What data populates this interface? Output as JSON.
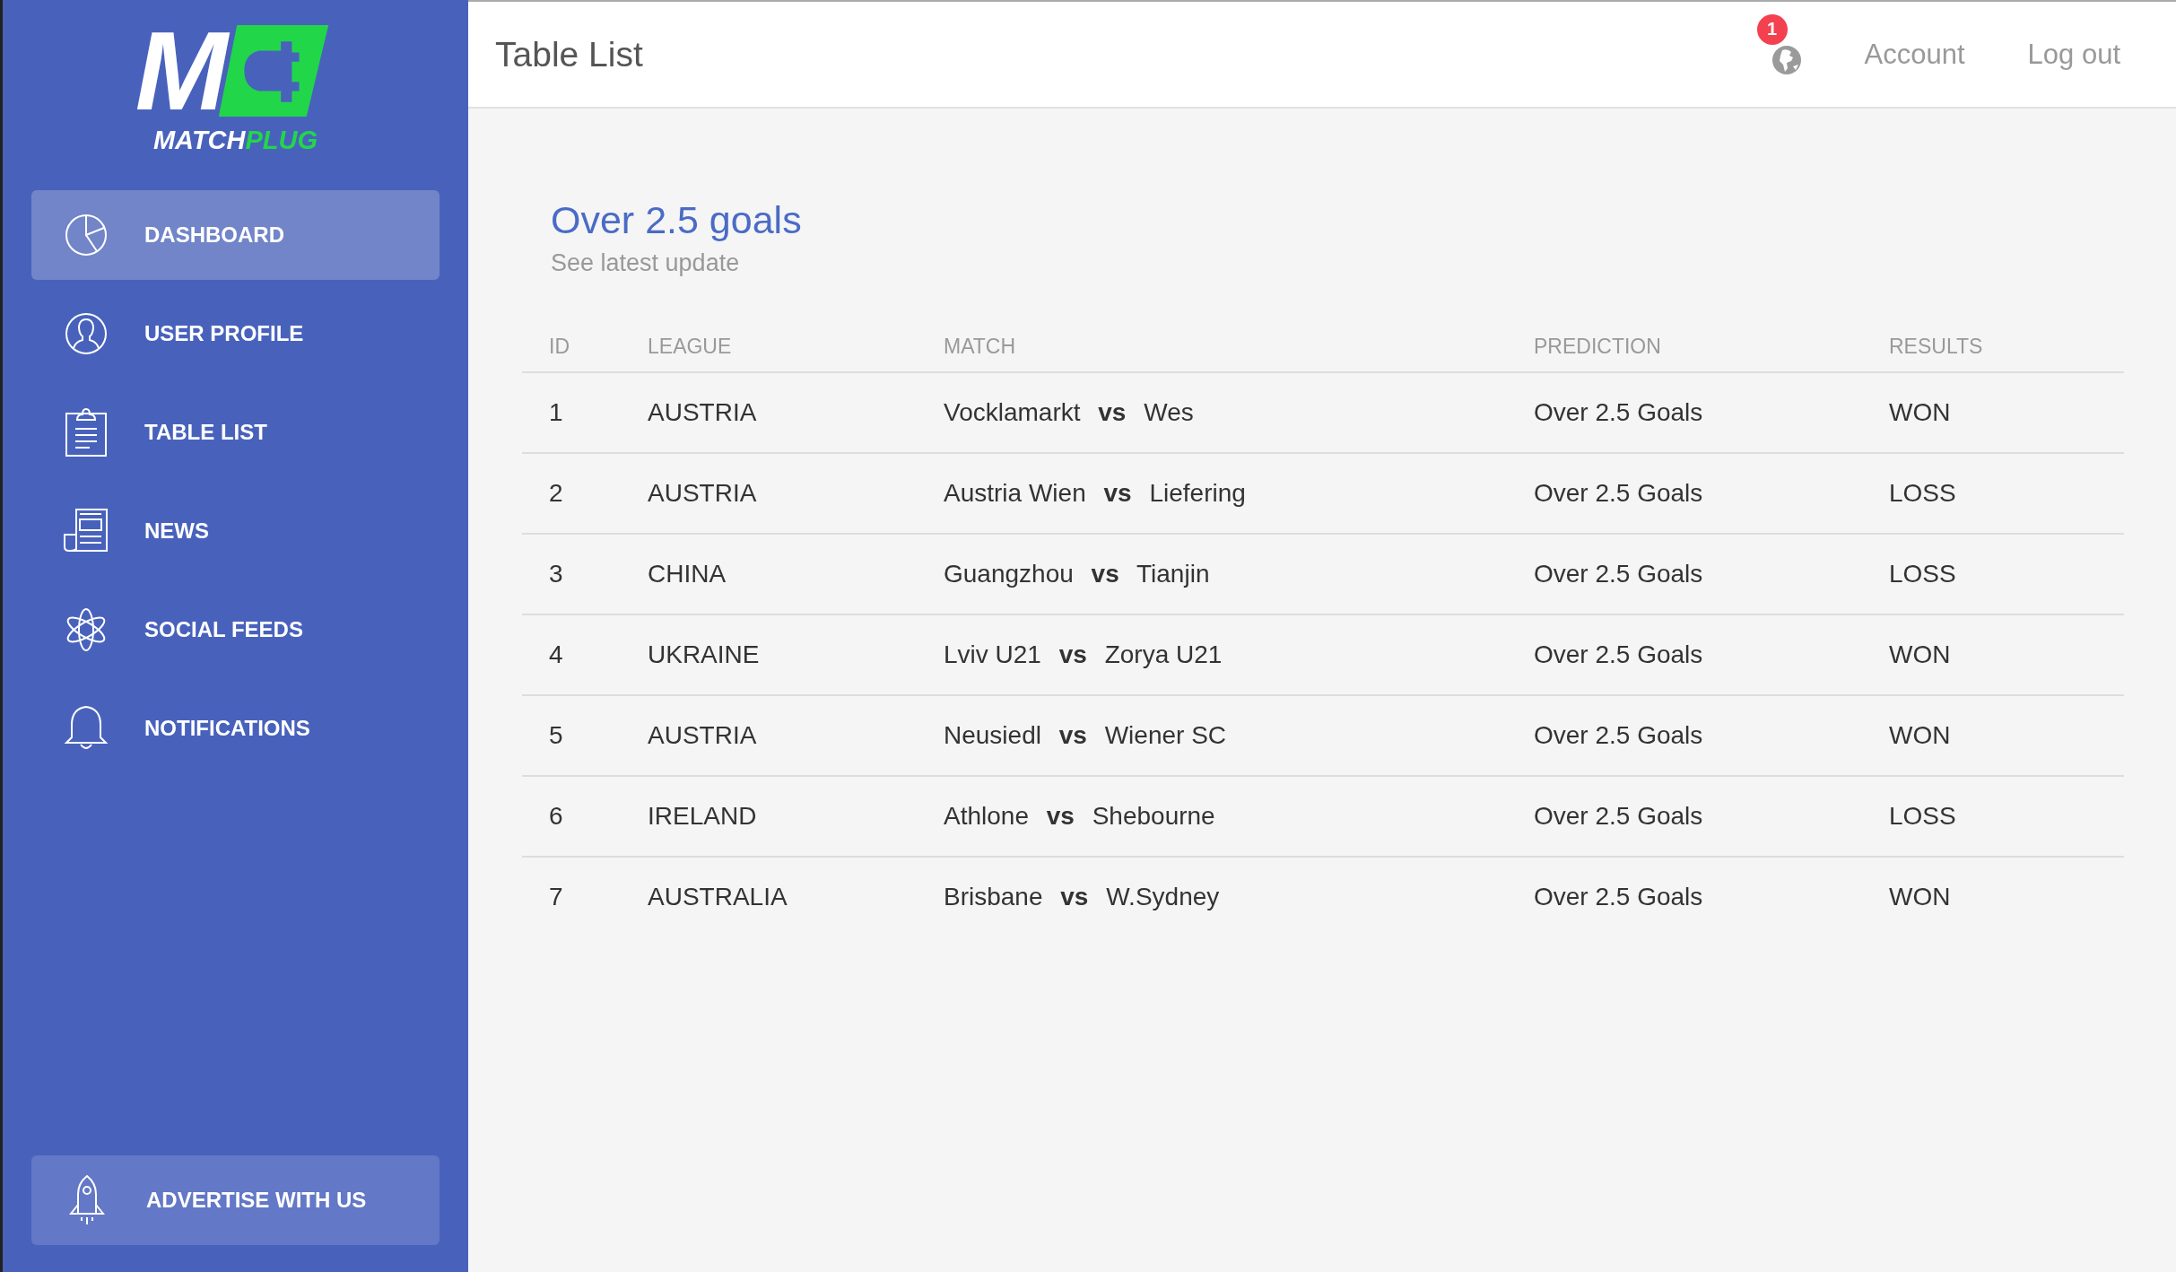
{
  "logo": {
    "monogram": "M",
    "wordmark": [
      {
        "text": "MATCH",
        "color": "#ffffff"
      },
      {
        "text": "PLUG",
        "color": "#22d64a"
      }
    ]
  },
  "sidebar": {
    "items": [
      {
        "label": "DASHBOARD",
        "selected": true
      },
      {
        "label": "USER PROFILE",
        "selected": false
      },
      {
        "label": "TABLE LIST",
        "selected": false
      },
      {
        "label": "NEWS",
        "selected": false
      },
      {
        "label": "SOCIAL FEEDS",
        "selected": false
      },
      {
        "label": "NOTIFICATIONS",
        "selected": false
      }
    ],
    "footer_button": {
      "label": "ADVERTISE WITH US"
    }
  },
  "header": {
    "title": "Table List",
    "notification_count": "1",
    "links": [
      "Account",
      "Log out"
    ]
  },
  "card": {
    "title": "Over 2.5 goals",
    "subtitle": "See latest update"
  },
  "table": {
    "columns": [
      "ID",
      "LEAGUE",
      "MATCH",
      "PREDICTION",
      "RESULTS"
    ],
    "rows": [
      [
        "1",
        "AUSTRIA",
        "Vocklamarkt **vs** Wes",
        "Over 2.5 Goals",
        "WON"
      ],
      [
        "2",
        "AUSTRIA",
        "Austria Wien **vs** Liefering",
        "Over 2.5 Goals",
        "LOSS"
      ],
      [
        "3",
        "CHINA",
        "Guangzhou **vs** Tianjin",
        "Over 2.5 Goals",
        "LOSS"
      ],
      [
        "4",
        "UKRAINE",
        "Lviv U21 **vs** Zorya U21",
        "Over 2.5 Goals",
        "WON"
      ],
      [
        "5",
        "AUSTRIA",
        "Neusiedl **vs** Wiener SC",
        "Over 2.5 Goals",
        "WON"
      ],
      [
        "6",
        "IRELAND",
        "Athlone **vs** Shebourne",
        "Over 2.5 Goals",
        "LOSS"
      ],
      [
        "7",
        "AUSTRALIA",
        "Brisbane **vs** W.Sydney",
        "Over 2.5 Goals",
        "WON"
      ]
    ]
  }
}
